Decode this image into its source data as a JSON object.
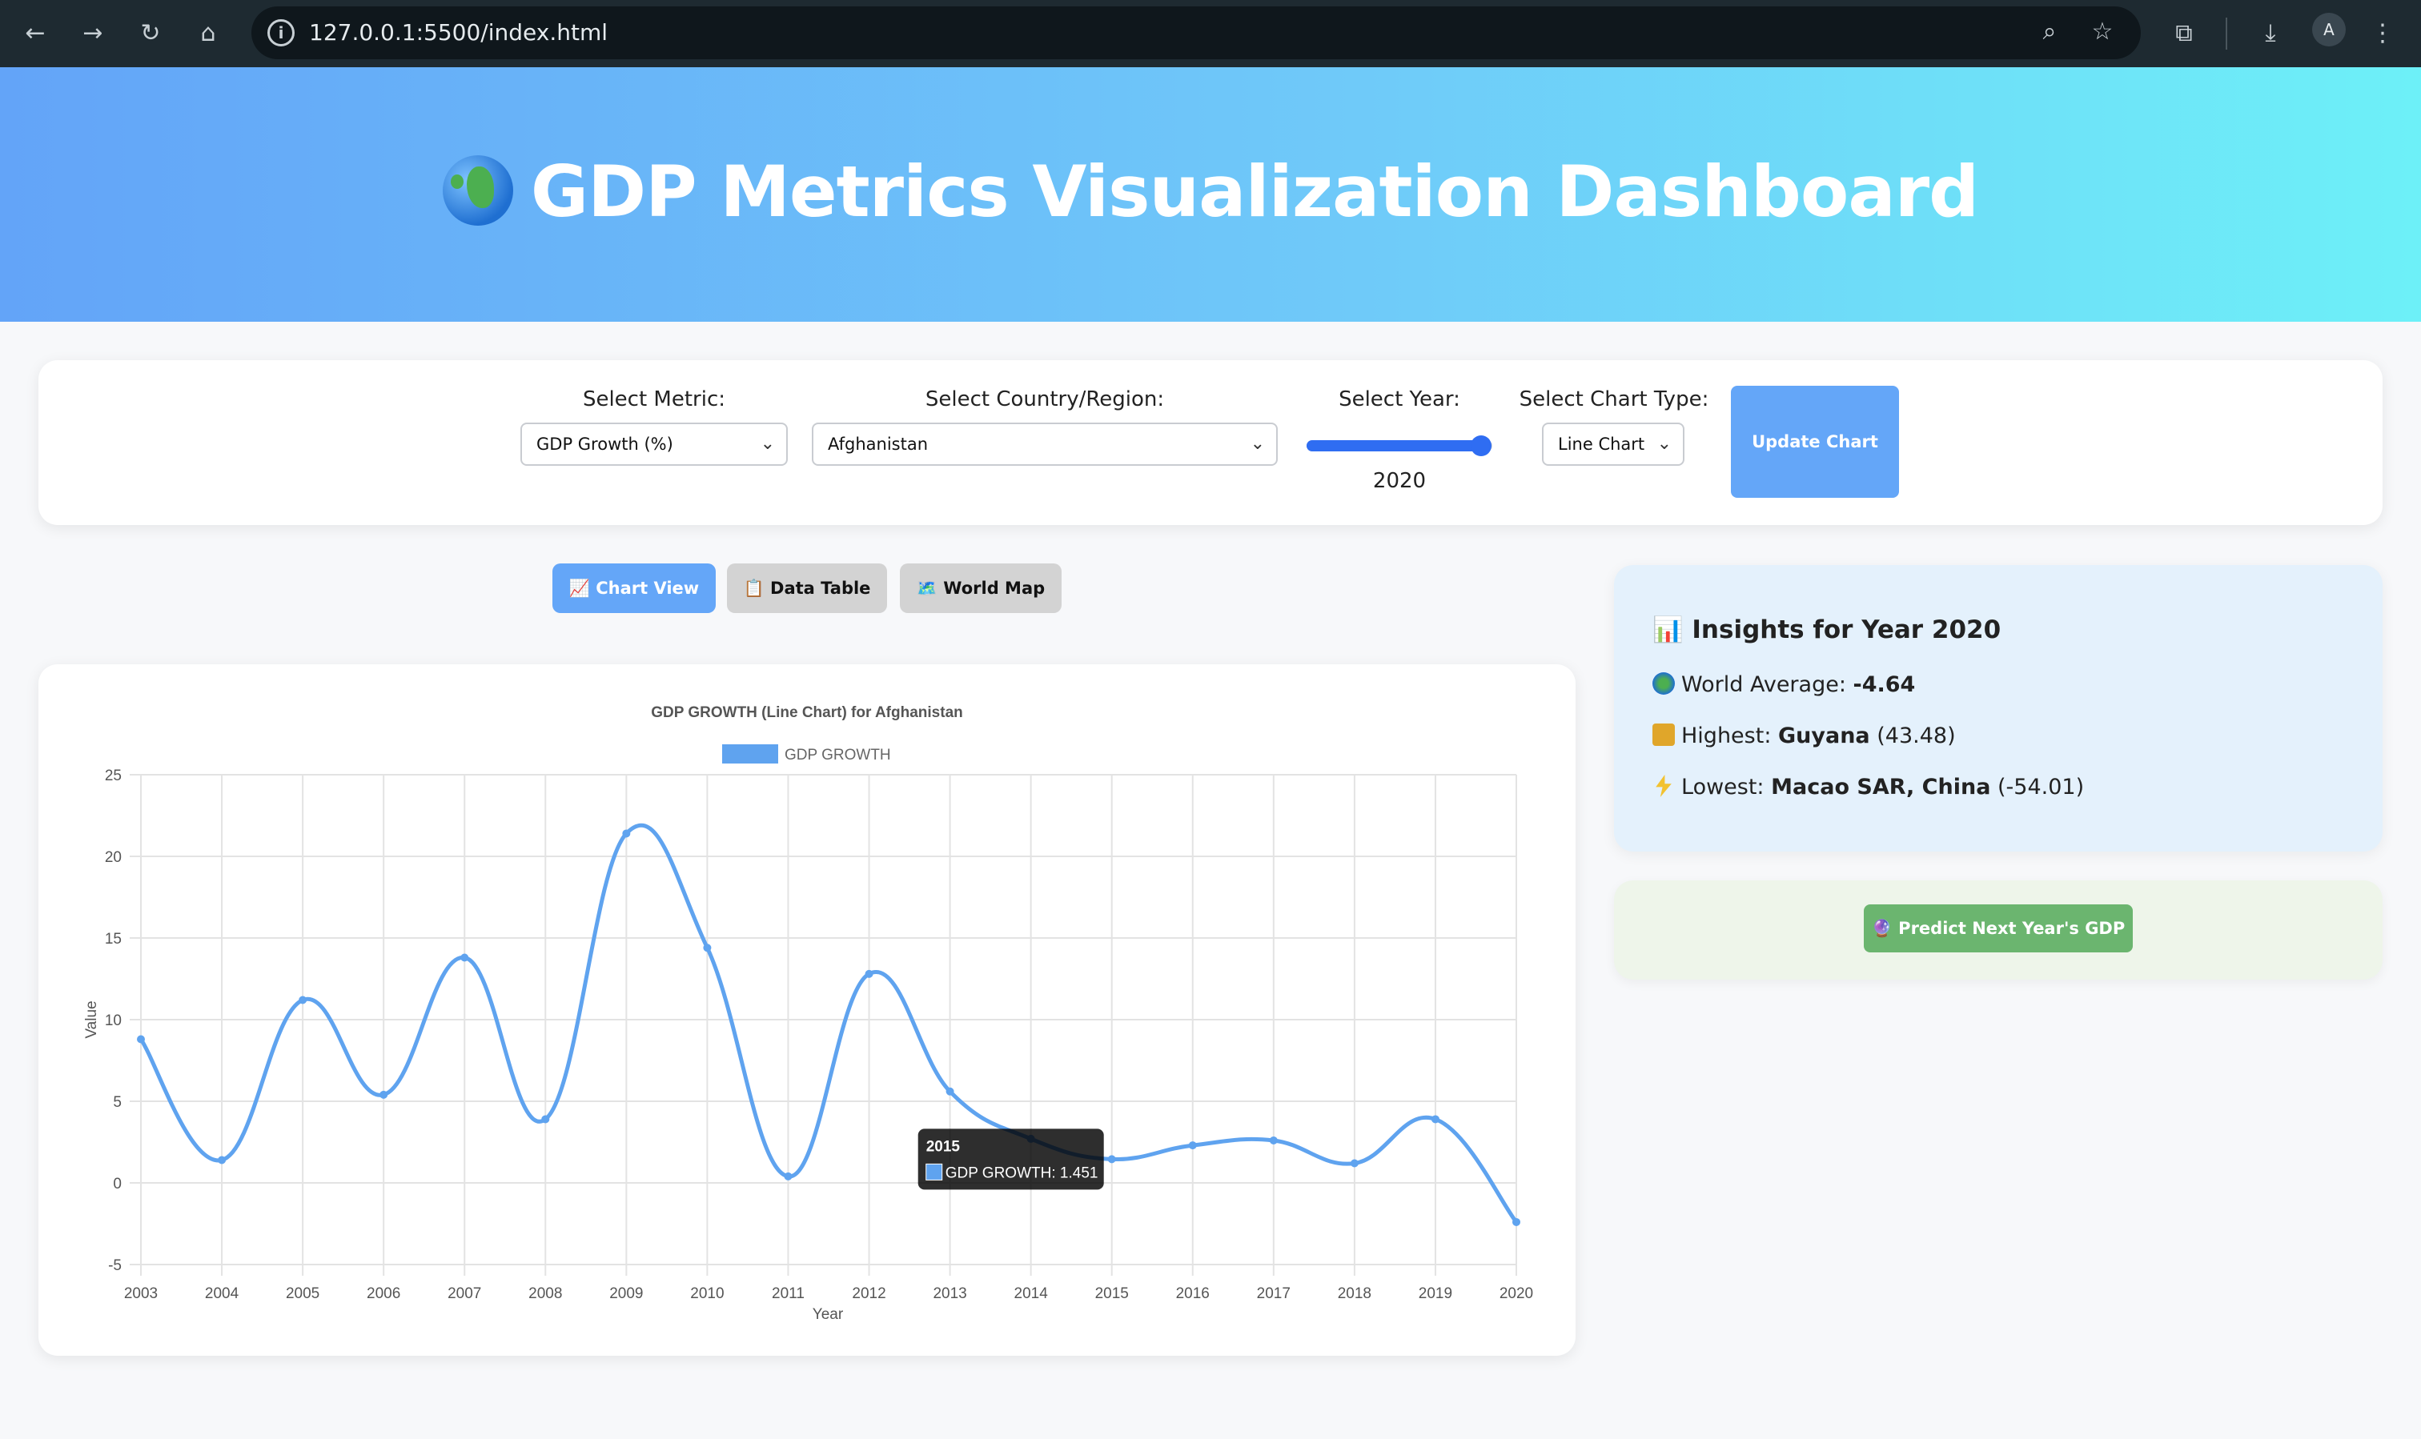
{
  "browser": {
    "url": "127.0.0.1:5500/index.html",
    "avatar_letter": "A"
  },
  "header": {
    "title": "GDP Metrics Visualization Dashboard",
    "icon": "globe-africa-emoji"
  },
  "controls": {
    "metric_label": "Select Metric:",
    "metric_value": "GDP Growth (%)",
    "country_label": "Select Country/Region:",
    "country_value": "Afghanistan",
    "year_label": "Select Year:",
    "year_value": "2020",
    "year_slider_fraction": 0.94,
    "chart_type_label": "Select Chart Type:",
    "chart_type_value": "Line Chart",
    "update_button": "Update Chart"
  },
  "tabs": [
    {
      "label": "📈 Chart View",
      "active": true
    },
    {
      "label": "📋 Data Table",
      "active": false
    },
    {
      "label": "🗺️ World Map",
      "active": false
    }
  ],
  "insights": {
    "title": "📊 Insights for Year 2020",
    "world_label": "World Average: ",
    "world_value": "-4.64",
    "highest_label": "Highest: ",
    "highest_country": "Guyana",
    "highest_value": "(43.48)",
    "lowest_label": "Lowest: ",
    "lowest_country": "Macao SAR, China",
    "lowest_value": "(-54.01)"
  },
  "predict_button": "🔮 Predict Next Year's GDP",
  "colors": {
    "accent": "#64a6f8",
    "line": "#5fa3ef",
    "predict": "#6bb56f"
  },
  "chart_data": {
    "type": "line",
    "title": "GDP GROWTH (Line Chart) for Afghanistan",
    "xlabel": "Year",
    "ylabel": "Value",
    "ylim": [
      -5,
      25
    ],
    "yticks": [
      -5,
      0,
      5,
      10,
      15,
      20,
      25
    ],
    "grid": true,
    "legend": "top-center",
    "x": [
      "2003",
      "2004",
      "2005",
      "2006",
      "2007",
      "2008",
      "2009",
      "2010",
      "2011",
      "2012",
      "2013",
      "2014",
      "2015",
      "2016",
      "2017",
      "2018",
      "2019",
      "2020"
    ],
    "series": [
      {
        "name": "GDP GROWTH",
        "values": [
          8.8,
          1.4,
          11.2,
          5.4,
          13.8,
          3.9,
          21.4,
          14.4,
          0.4,
          12.8,
          5.6,
          2.7,
          1.451,
          2.3,
          2.6,
          1.2,
          3.9,
          -2.4
        ]
      }
    ],
    "tooltip": {
      "title": "2015",
      "label": "GDP GROWTH: 1.451"
    }
  }
}
